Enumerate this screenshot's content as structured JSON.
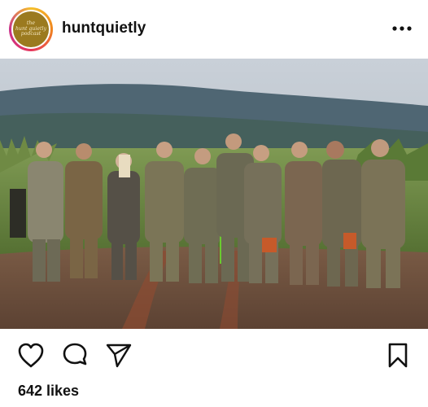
{
  "post": {
    "username": "huntquietly",
    "avatar_text": [
      "the",
      "hunt quietly",
      "podcast"
    ],
    "more_icon": "more-horizontal-icon",
    "likes_text": "642 likes"
  },
  "actions": {
    "like_icon": "heart-icon",
    "comment_icon": "comment-icon",
    "share_icon": "send-icon",
    "save_icon": "bookmark-icon"
  },
  "colors": {
    "ring_start": "#f5c02a",
    "ring_end": "#c8318e",
    "avatar_bg": "#9b7a1f"
  }
}
